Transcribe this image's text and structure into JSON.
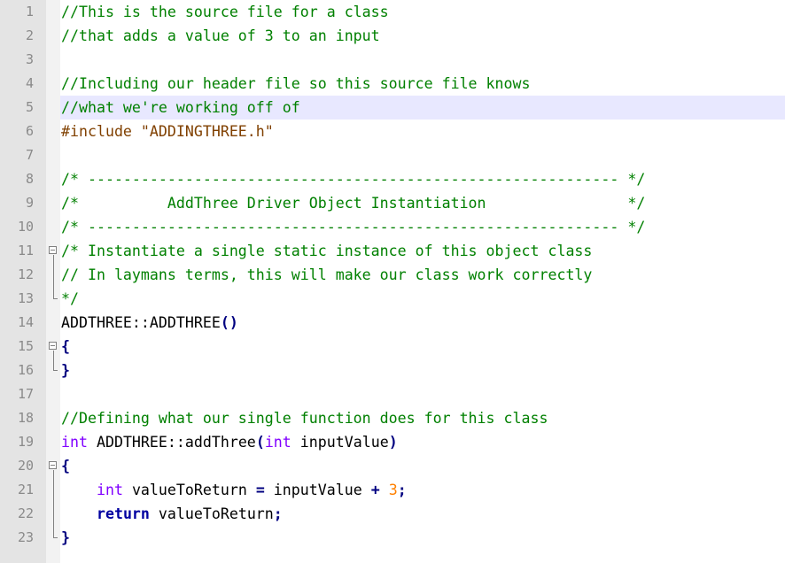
{
  "editor": {
    "lines": [
      {
        "num": "1",
        "parts": [
          {
            "c": "cm",
            "t": "//This is the source file for a class"
          }
        ]
      },
      {
        "num": "2",
        "parts": [
          {
            "c": "cm",
            "t": "//that adds a value of 3 to an input"
          }
        ]
      },
      {
        "num": "3",
        "parts": []
      },
      {
        "num": "4",
        "parts": [
          {
            "c": "cm",
            "t": "//Including our header file so this source file knows"
          }
        ]
      },
      {
        "num": "5",
        "current": true,
        "parts": [
          {
            "c": "cm",
            "t": "//what we're working off of"
          }
        ]
      },
      {
        "num": "6",
        "parts": [
          {
            "c": "pp",
            "t": "#include \"ADDINGTHREE.h\""
          }
        ]
      },
      {
        "num": "7",
        "parts": []
      },
      {
        "num": "8",
        "parts": [
          {
            "c": "cm",
            "t": "/* ------------------------------------------------------------ */"
          }
        ]
      },
      {
        "num": "9",
        "parts": [
          {
            "c": "cm",
            "t": "/*          AddThree Driver Object Instantiation                */"
          }
        ]
      },
      {
        "num": "10",
        "parts": [
          {
            "c": "cm",
            "t": "/* ------------------------------------------------------------ */"
          }
        ]
      },
      {
        "num": "11",
        "fold": "open",
        "parts": [
          {
            "c": "cm",
            "t": "/* Instantiate a single static instance of this object class"
          }
        ]
      },
      {
        "num": "12",
        "parts": [
          {
            "c": "cm",
            "t": "// In laymans terms, this will make our class work correctly"
          }
        ]
      },
      {
        "num": "13",
        "parts": [
          {
            "c": "cm",
            "t": "*/"
          }
        ]
      },
      {
        "num": "14",
        "parts": [
          {
            "c": "tx",
            "t": "ADDTHREE::ADDTHREE"
          },
          {
            "c": "op",
            "t": "()"
          }
        ]
      },
      {
        "num": "15",
        "fold": "open",
        "parts": [
          {
            "c": "op",
            "t": "{"
          }
        ]
      },
      {
        "num": "16",
        "parts": [
          {
            "c": "op",
            "t": "}"
          }
        ]
      },
      {
        "num": "17",
        "parts": []
      },
      {
        "num": "18",
        "parts": [
          {
            "c": "cm",
            "t": "//Defining what our single function does for this class"
          }
        ]
      },
      {
        "num": "19",
        "parts": [
          {
            "c": "kw",
            "t": "int"
          },
          {
            "c": "tx",
            "t": " ADDTHREE::addThree"
          },
          {
            "c": "op",
            "t": "("
          },
          {
            "c": "kw",
            "t": "int"
          },
          {
            "c": "tx",
            "t": " inputValue"
          },
          {
            "c": "op",
            "t": ")"
          }
        ]
      },
      {
        "num": "20",
        "fold": "open",
        "parts": [
          {
            "c": "op",
            "t": "{"
          }
        ]
      },
      {
        "num": "21",
        "parts": [
          {
            "c": "tx",
            "t": "    "
          },
          {
            "c": "kw",
            "t": "int"
          },
          {
            "c": "tx",
            "t": " valueToReturn "
          },
          {
            "c": "op",
            "t": "="
          },
          {
            "c": "tx",
            "t": " inputValue "
          },
          {
            "c": "op",
            "t": "+"
          },
          {
            "c": "tx",
            "t": " "
          },
          {
            "c": "nm",
            "t": "3"
          },
          {
            "c": "op",
            "t": ";"
          }
        ]
      },
      {
        "num": "22",
        "parts": [
          {
            "c": "tx",
            "t": "    "
          },
          {
            "c": "kwb",
            "t": "return"
          },
          {
            "c": "tx",
            "t": " valueToReturn"
          },
          {
            "c": "op",
            "t": ";"
          }
        ]
      },
      {
        "num": "23",
        "parts": [
          {
            "c": "op",
            "t": "}"
          }
        ]
      }
    ]
  }
}
